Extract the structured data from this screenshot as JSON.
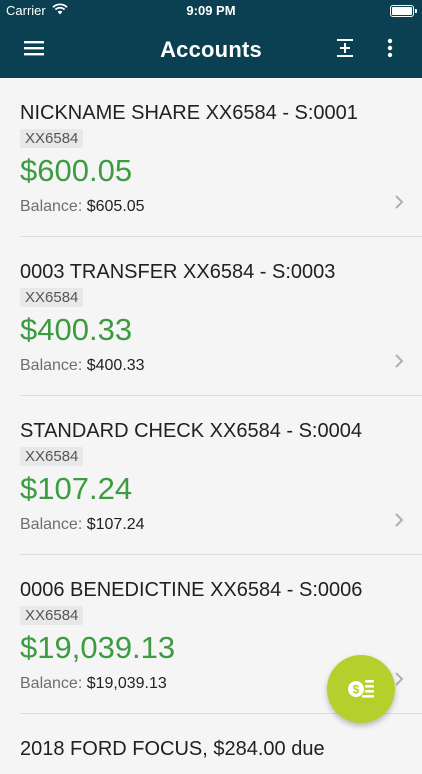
{
  "status_bar": {
    "carrier": "Carrier",
    "time": "9:09 PM"
  },
  "header": {
    "title": "Accounts",
    "icons": [
      "menu-icon",
      "expand-collapse-icon",
      "more-vertical-icon"
    ]
  },
  "balance_label": "Balance:",
  "accounts": [
    {
      "name": "NICKNAME SHARE XX6584 - S:0001",
      "mask": "XX6584",
      "available": "$600.05",
      "balance": "$605.05"
    },
    {
      "name": "0003 TRANSFER XX6584 - S:0003",
      "mask": "XX6584",
      "available": "$400.33",
      "balance": "$400.33"
    },
    {
      "name": "STANDARD CHECK XX6584 - S:0004",
      "mask": "XX6584",
      "available": "$107.24",
      "balance": "$107.24"
    },
    {
      "name": "0006 BENEDICTINE XX6584 - S:0006",
      "mask": "XX6584",
      "available": "$19,039.13",
      "balance": "$19,039.13"
    },
    {
      "name": "2018 FORD FOCUS, $284.00 due"
    }
  ],
  "fab": {
    "icon": "money-transfer-icon"
  },
  "colors": {
    "header_bg": "#0a4052",
    "amount_green": "#3d9b41",
    "fab_bg": "#b5cf2d"
  }
}
